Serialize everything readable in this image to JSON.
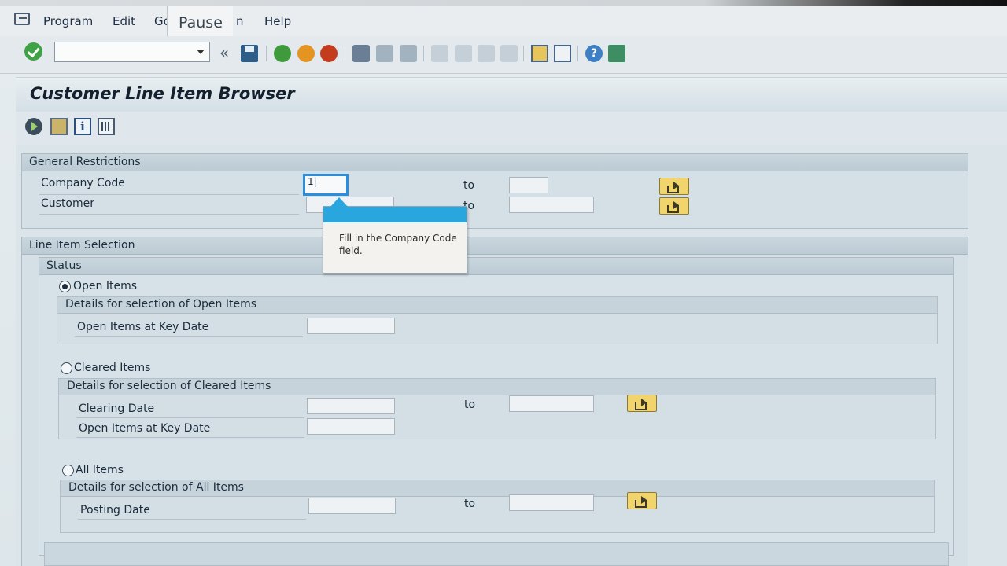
{
  "menubar": {
    "items": [
      "Program",
      "Edit",
      "Go",
      "n",
      "Help"
    ],
    "overlay_text": "Pause"
  },
  "toolbar": {
    "command_field_value": "",
    "back_glyph": "«"
  },
  "page": {
    "title": "Customer Line Item Browser"
  },
  "general_restrictions": {
    "header": "General Restrictions",
    "company_code_label": "Company Code",
    "company_code_value": "1|",
    "company_code_to_value": "",
    "customer_label": "Customer",
    "customer_value": "",
    "customer_to_value": "",
    "to_label": "to"
  },
  "tooltip": {
    "text": "Fill in the Company Code  field."
  },
  "line_item_selection": {
    "header": "Line Item Selection",
    "status_header": "Status",
    "open_items": {
      "radio_label": "Open Items",
      "selected": true,
      "details_header": "Details for selection of Open Items",
      "key_date_label": "Open Items at Key Date",
      "key_date_value": ""
    },
    "cleared_items": {
      "radio_label": "Cleared Items",
      "selected": false,
      "details_header": "Details for selection of Cleared Items",
      "clearing_date_label": "Clearing Date",
      "clearing_date_value": "",
      "clearing_date_to_value": "",
      "key_date_label": "Open Items at Key Date",
      "key_date_value": ""
    },
    "all_items": {
      "radio_label": "All Items",
      "selected": false,
      "details_header": "Details for selection of All Items",
      "posting_date_label": "Posting Date",
      "posting_date_value": "",
      "posting_date_to_value": ""
    },
    "to_label": "to"
  }
}
